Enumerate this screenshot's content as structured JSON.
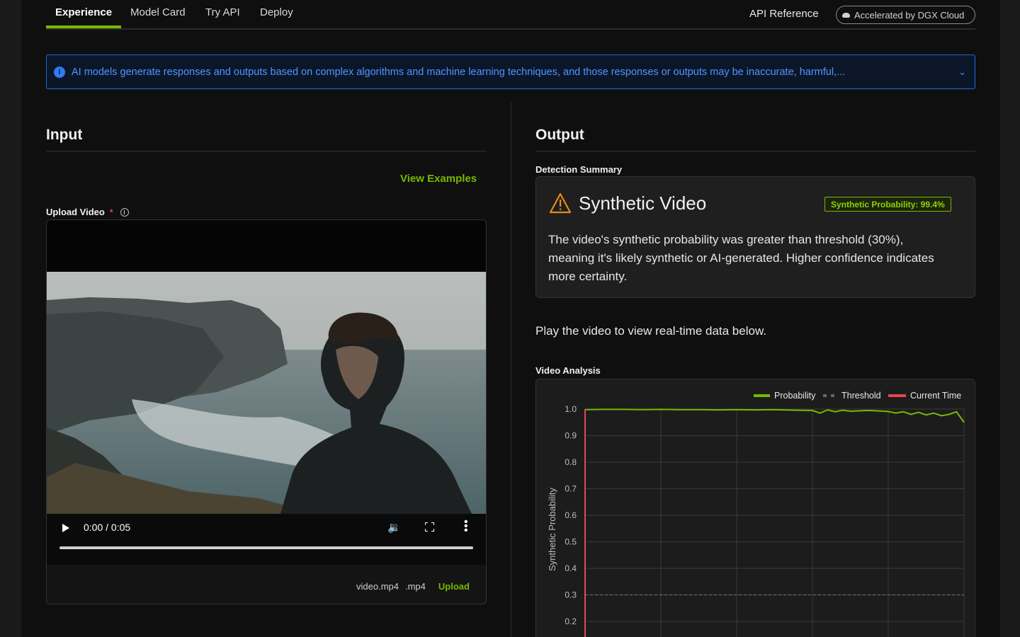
{
  "nav": {
    "tabs": [
      "Experience",
      "Model Card",
      "Try API",
      "Deploy"
    ],
    "active_tab": "Experience",
    "api_reference": "API Reference",
    "accelerated": "Accelerated by DGX Cloud"
  },
  "banner": {
    "text": "AI models generate responses and outputs based on complex algorithms and machine learning techniques, and those responses or outputs may be inaccurate, harmful,..."
  },
  "input": {
    "title": "Input",
    "view_examples": "View Examples",
    "upload_label": "Upload Video",
    "required_mark": "*",
    "player": {
      "time": "0:00 / 0:05"
    },
    "file_name": "video.mp4",
    "file_ext": ".mp4",
    "upload_button": "Upload"
  },
  "output": {
    "title": "Output",
    "detection_summary_label": "Detection Summary",
    "result_title": "Synthetic Video",
    "probability_badge": "Synthetic Probability: 99.4%",
    "summary_text": "The video's synthetic probability was greater than threshold (30%), meaning it's likely synthetic or AI-generated. Higher confidence indicates more certainty.",
    "play_note": "Play the video to view real-time data below.",
    "video_analysis_label": "Video Analysis"
  },
  "colors": {
    "accent": "#76b900",
    "info": "#1c6ad6",
    "threshold": "#666666",
    "current_time": "#e5484d"
  },
  "chart_data": {
    "type": "line",
    "ylabel": "Synthetic Probability",
    "yticks": [
      "1.0",
      "0.9",
      "0.8",
      "0.7",
      "0.6",
      "0.5",
      "0.4",
      "0.3",
      "0.2"
    ],
    "legend": [
      {
        "name": "Probability",
        "color": "#76b900",
        "style": "solid"
      },
      {
        "name": "Threshold",
        "color": "#666666",
        "style": "dashed"
      },
      {
        "name": "Current Time",
        "color": "#e5484d",
        "style": "solid"
      }
    ],
    "legend_position": "top-right",
    "threshold": 0.3,
    "current_time": 0,
    "x": [
      0,
      0.25,
      0.5,
      0.75,
      1.0,
      1.25,
      1.5,
      1.75,
      2.0,
      2.25,
      2.5,
      2.75,
      3.0,
      3.1,
      3.2,
      3.3,
      3.4,
      3.5,
      3.75,
      4.0,
      4.1,
      4.2,
      4.3,
      4.4,
      4.5,
      4.6,
      4.7,
      4.8,
      4.9,
      5.0
    ],
    "y": [
      0.998,
      0.999,
      0.999,
      0.998,
      0.999,
      0.998,
      0.998,
      0.997,
      0.998,
      0.997,
      0.998,
      0.996,
      0.995,
      0.985,
      0.997,
      0.99,
      0.996,
      0.992,
      0.995,
      0.991,
      0.985,
      0.99,
      0.98,
      0.988,
      0.978,
      0.985,
      0.975,
      0.98,
      0.99,
      0.95
    ],
    "xlim": [
      0,
      5
    ],
    "ylim": [
      0.2,
      1.0
    ],
    "grid": true
  }
}
